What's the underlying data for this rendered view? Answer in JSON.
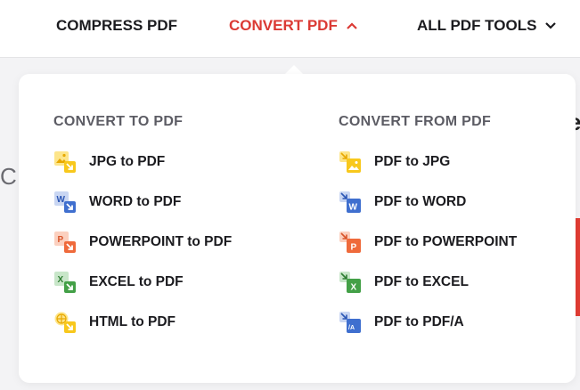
{
  "nav": {
    "compress": "COMPRESS PDF",
    "convert": "CONVERT PDF",
    "all_tools": "ALL PDF TOOLS"
  },
  "background": {
    "glyph_left": "C",
    "glyph_right": "e"
  },
  "menu": {
    "to_pdf": {
      "title": "CONVERT TO PDF",
      "items": [
        {
          "label": "JPG to PDF",
          "icon": "jpg-to-pdf-icon"
        },
        {
          "label": "WORD to PDF",
          "icon": "word-to-pdf-icon"
        },
        {
          "label": "POWERPOINT to PDF",
          "icon": "powerpoint-to-pdf-icon"
        },
        {
          "label": "EXCEL to PDF",
          "icon": "excel-to-pdf-icon"
        },
        {
          "label": "HTML to PDF",
          "icon": "html-to-pdf-icon"
        }
      ]
    },
    "from_pdf": {
      "title": "CONVERT FROM PDF",
      "items": [
        {
          "label": "PDF to JPG",
          "icon": "pdf-to-jpg-icon"
        },
        {
          "label": "PDF to WORD",
          "icon": "pdf-to-word-icon"
        },
        {
          "label": "PDF to POWERPOINT",
          "icon": "pdf-to-powerpoint-icon"
        },
        {
          "label": "PDF to EXCEL",
          "icon": "pdf-to-excel-icon"
        },
        {
          "label": "PDF to PDF/A",
          "icon": "pdf-to-pdfa-icon"
        }
      ]
    }
  },
  "colors": {
    "accent": "#db3a34",
    "jpg": "#f8c81c",
    "word": "#3f6fcf",
    "powerpoint": "#ef6a3b",
    "excel": "#43a047",
    "pdfa": "#3f6fcf"
  }
}
